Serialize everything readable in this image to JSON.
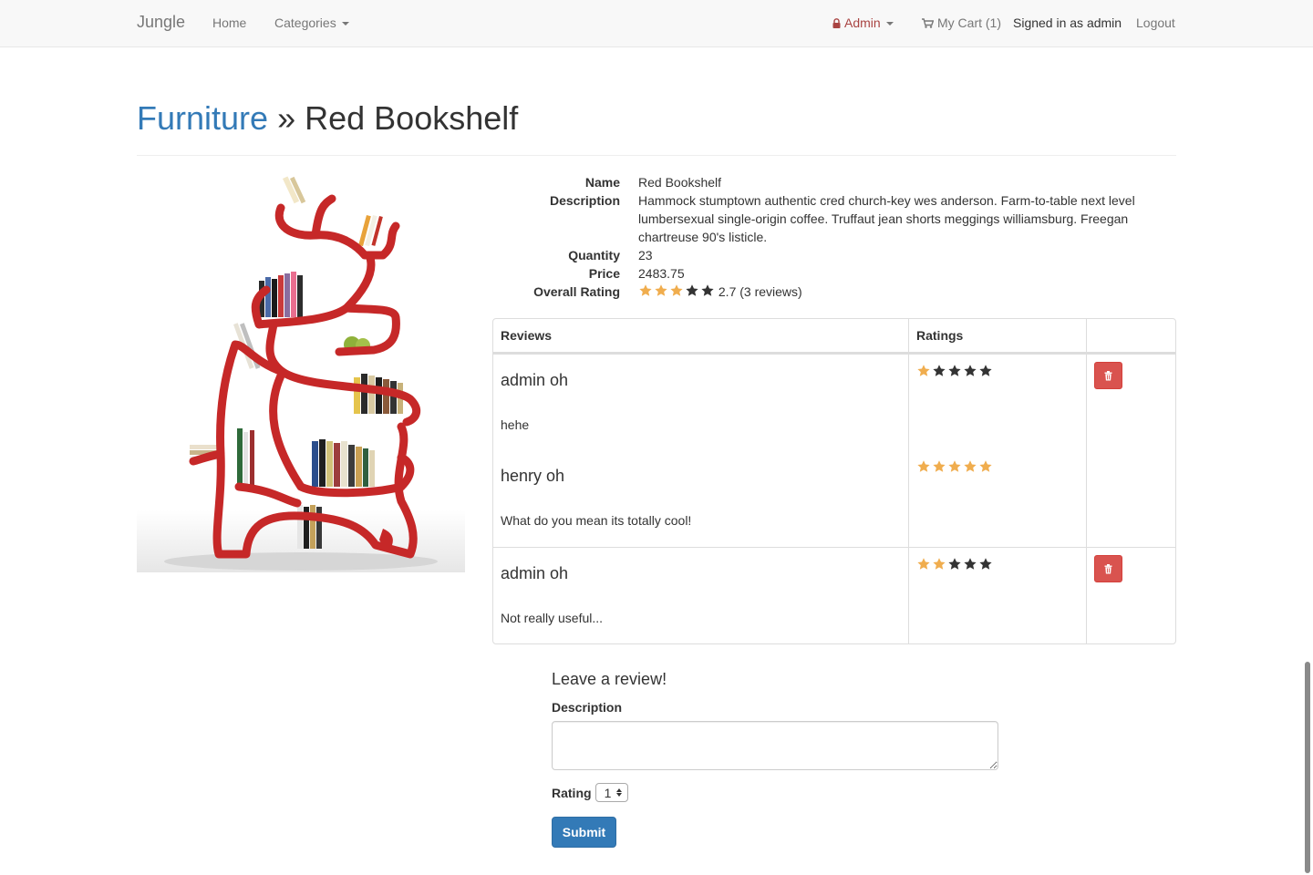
{
  "navbar": {
    "brand": "Jungle",
    "home": "Home",
    "categories": "Categories",
    "admin": "Admin",
    "cart": "My Cart (1)",
    "signed_in": "Signed in as admin",
    "logout": "Logout"
  },
  "breadcrumb": {
    "category": "Furniture",
    "separator": "»",
    "product": "Red Bookshelf"
  },
  "product": {
    "image_icon": "red-bookshelf-image",
    "labels": {
      "name": "Name",
      "description": "Description",
      "quantity": "Quantity",
      "price": "Price",
      "overall_rating": "Overall Rating"
    },
    "name": "Red Bookshelf",
    "description": "Hammock stumptown authentic cred church-key wes anderson. Farm-to-table next level lumbersexual single-origin coffee. Truffaut jean shorts meggings williamsburg. Freegan chartreuse 90's listicle.",
    "quantity": "23",
    "price": "2483.75",
    "overall_rating_value": 3,
    "overall_rating_text": "2.7 (3 reviews)"
  },
  "reviews_table": {
    "headers": {
      "reviews": "Reviews",
      "ratings": "Ratings"
    },
    "rows": [
      {
        "user": "admin oh",
        "description": "hehe",
        "rating": 1,
        "deletable": true
      },
      {
        "user": "henry oh",
        "description": "What do you mean its totally cool!",
        "rating": 5,
        "deletable": false
      },
      {
        "user": "admin oh",
        "description": "Not really useful...",
        "rating": 2,
        "deletable": true
      }
    ]
  },
  "review_form": {
    "title": "Leave a review!",
    "description_label": "Description",
    "description_value": "",
    "rating_label": "Rating",
    "rating_selected": "1",
    "submit_label": "Submit"
  },
  "colors": {
    "star_filled": "#f0ad4e",
    "star_empty": "#333333",
    "link": "#337ab7",
    "admin": "#a94442",
    "danger": "#d9534f",
    "primary": "#337ab7"
  },
  "icons": {
    "admin": "lock-icon",
    "cart": "shopping-cart-icon",
    "delete": "trash-icon",
    "star": "star-icon"
  }
}
